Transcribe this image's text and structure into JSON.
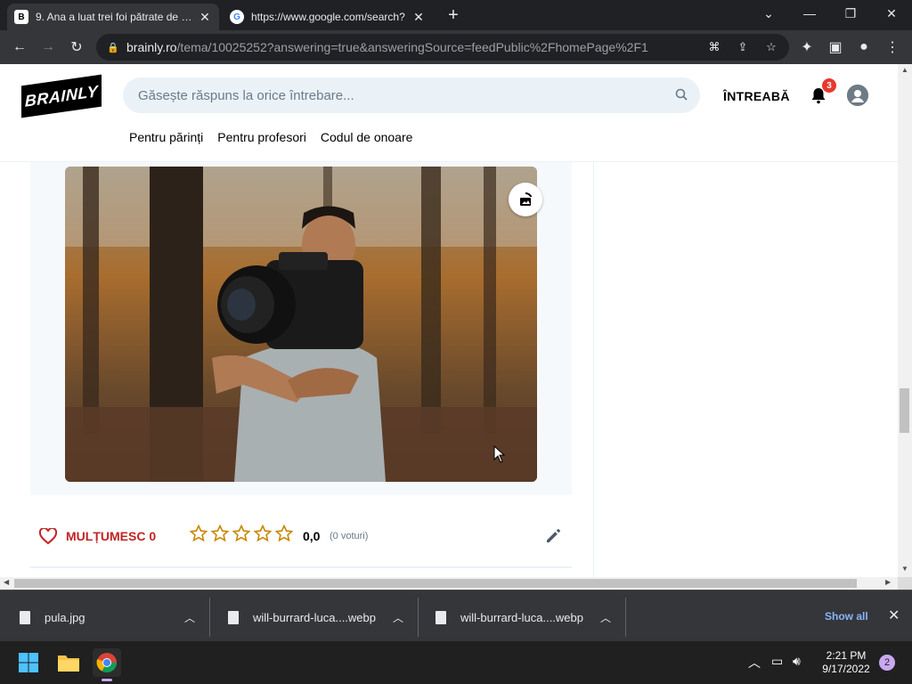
{
  "browser": {
    "tabs": [
      {
        "title": "9. Ana a luat trei foi pătrate de ca",
        "favicon": "B",
        "active": true
      },
      {
        "title": "https://www.google.com/search?",
        "favicon": "G",
        "active": false
      }
    ],
    "address": {
      "host": "brainly.ro",
      "path": "/tema/10025252?answering=true&answeringSource=feedPublic%2FhomePage%2F1"
    }
  },
  "site": {
    "logo": "BRAINLY",
    "search_placeholder": "Găsește răspuns la orice întrebare...",
    "ask_label": "ÎNTREABĂ",
    "notification_count": "3",
    "subnav": [
      "Pentru părinți",
      "Pentru profesori",
      "Codul de onoare"
    ]
  },
  "answer": {
    "thanks_label": "MULȚUMESC 0",
    "rating": "0,0",
    "votes": "(0 voturi)",
    "stars": 5
  },
  "downloads": {
    "items": [
      "pula.jpg",
      "will-burrard-luca....webp",
      "will-burrard-luca....webp"
    ],
    "show_all": "Show all"
  },
  "taskbar": {
    "time": "2:21 PM",
    "date": "9/17/2022",
    "notifications": "2"
  },
  "colors": {
    "accent_red": "#c32323",
    "star_gold": "#c98600",
    "link_blue": "#8ab4f8"
  }
}
